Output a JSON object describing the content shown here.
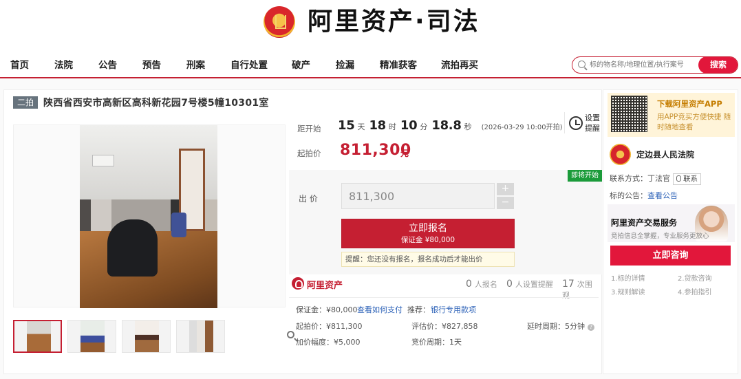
{
  "header": {
    "brand_title": "阿里资产·司法"
  },
  "nav": {
    "items": [
      "首页",
      "法院",
      "公告",
      "预告",
      "刑案",
      "自行处置",
      "破产",
      "捡漏",
      "精准获客",
      "流拍再买"
    ]
  },
  "search": {
    "placeholder": "标的物名称/地理位置/执行案号",
    "button": "搜索"
  },
  "listing": {
    "round": "二拍",
    "title": "陕西省西安市高新区高科新花园7号楼5幢10301室"
  },
  "auction": {
    "countdown_label": "距开始",
    "countdown": [
      {
        "value": "15",
        "unit": "天"
      },
      {
        "value": "18",
        "unit": "时"
      },
      {
        "value": "10",
        "unit": "分"
      },
      {
        "value": "18.8",
        "unit": "秒"
      }
    ],
    "start_time": "(2026-03-29 10:00开拍)",
    "reminder_label": "设置提醒",
    "starting_price_label": "起拍价",
    "starting_price": "811,300",
    "currency": "元",
    "status": "即将开始",
    "bid_label": "出 价",
    "bid_value": "811,300",
    "plus": "+",
    "minus": "−",
    "signup_button": "立即报名",
    "deposit_note": "保证金 ¥80,000",
    "notice": "提醒：您还没有报名，报名成功后才能出价"
  },
  "platform": {
    "name": "阿里资产",
    "stats": [
      {
        "value": "0",
        "label": "人报名"
      },
      {
        "value": "0",
        "label": "人设置提醒"
      },
      {
        "value": "17",
        "label": "次围观"
      }
    ],
    "deposit_label": "保证金：¥80,000",
    "pay_link": "查看如何支付",
    "recommend_label": "推荐：",
    "bank_link": "银行专用款项",
    "start_price": "起拍价：¥811,300",
    "evaluate_price": "评估价：¥827,858",
    "delay": "延时周期：5分钟",
    "increment": "加价幅度：¥5,000",
    "bid_period": "竞价周期：1天"
  },
  "sidebar": {
    "app_title": "下载阿里资产APP",
    "app_subtitle": "用APP竞买方便快捷 随时随地查看",
    "court_name": "定边县人民法院",
    "contact_label": "联系方式：丁法官",
    "contact_button": "联系",
    "announcement_label": "标的公告：",
    "announcement_link": "查看公告",
    "service_title": "阿里资产交易服务",
    "service_subtitle": "竞拍信息全掌握，专业服务更放心",
    "consult_button": "立即咨询",
    "guides": [
      "1.标的详情",
      "2.贷款咨询",
      "3.规则解读",
      "4.参拍指引"
    ]
  }
}
